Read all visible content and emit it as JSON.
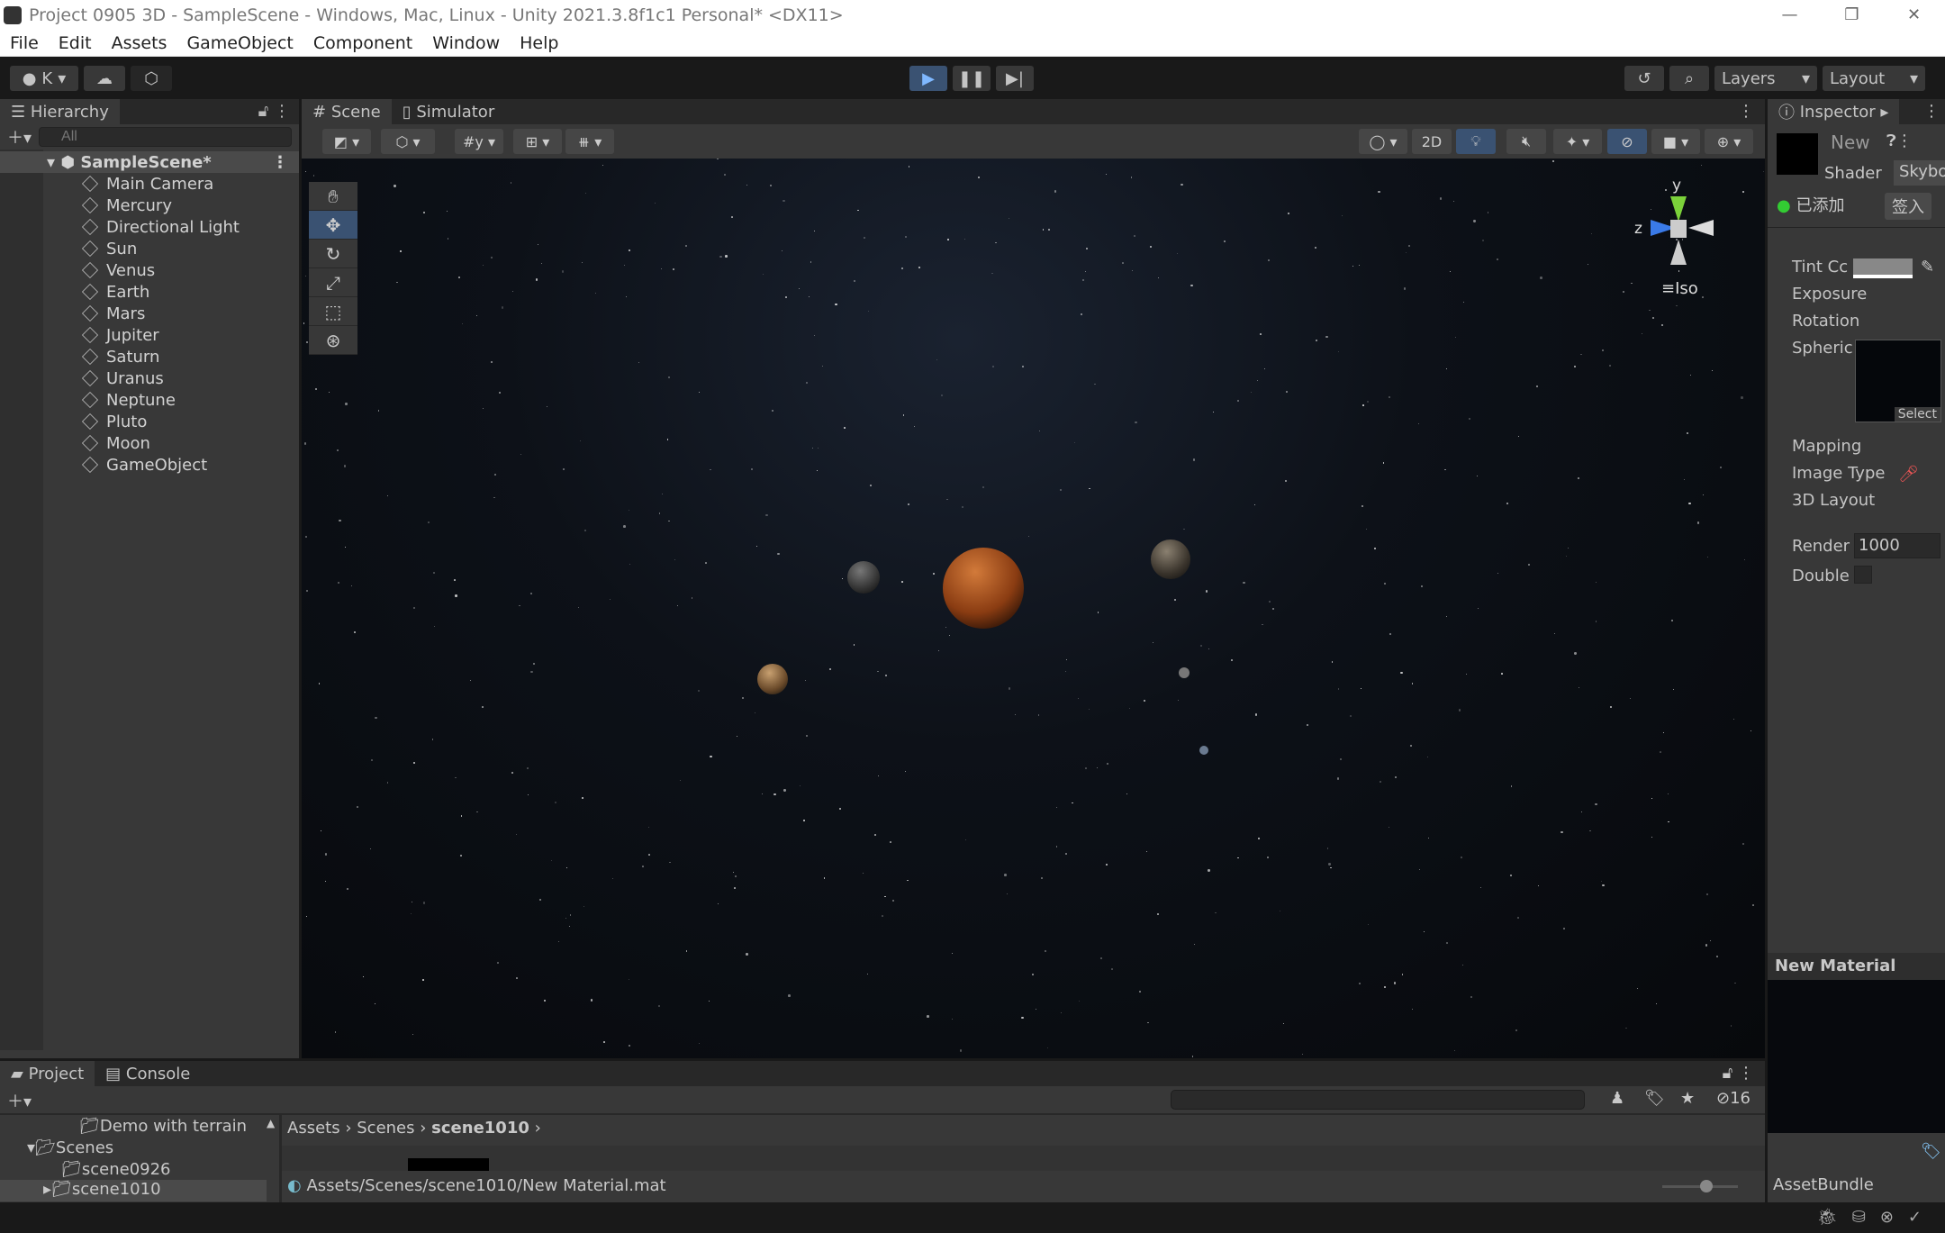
{
  "window": {
    "title": "Project 0905 3D - SampleScene - Windows, Mac, Linux - Unity 2021.3.8f1c1 Personal* <DX11>",
    "controls": [
      "—",
      "❐",
      "✕"
    ]
  },
  "menu": [
    "File",
    "Edit",
    "Assets",
    "GameObject",
    "Component",
    "Window",
    "Help"
  ],
  "toolbar": {
    "account": "K",
    "layers": "Layers",
    "layout": "Layout"
  },
  "hierarchy": {
    "tab": "Hierarchy",
    "search_placeholder": "All",
    "scene": "SampleScene*",
    "items": [
      "Main Camera",
      "Mercury",
      "Directional Light",
      "Sun",
      "Venus",
      "Earth",
      "Mars",
      "Jupiter",
      "Saturn",
      "Uranus",
      "Neptune",
      "Pluto",
      "Moon",
      "GameObject"
    ]
  },
  "scene": {
    "tabs": [
      "Scene",
      "Simulator"
    ],
    "btn_2d": "2D",
    "gizmo_y": "y",
    "gizmo_z": "z",
    "projection": "Iso"
  },
  "inspector": {
    "tab": "Inspector",
    "name": "New",
    "shader_label": "Shader",
    "shader_value": "Skybo",
    "added": "已添加",
    "checkin": "签入",
    "props": [
      "Tint Cc",
      "Exposure",
      "Rotation",
      "Spheric",
      "Mapping",
      "Image Type",
      "3D Layout"
    ],
    "render_label": "Render",
    "render_value": "1000",
    "double_label": "Double",
    "select": "Select",
    "preview_title": "New Material",
    "assetbundle": "AssetBundle"
  },
  "project": {
    "tabs": [
      "Project",
      "Console"
    ],
    "tree": [
      "Demo with terrain",
      "Scenes",
      "scene0926",
      "scene1010"
    ],
    "breadcrumb": [
      "Assets",
      "Scenes",
      "scene1010"
    ],
    "hidden_count": "16",
    "selected_path": "Assets/Scenes/scene1010/New Material.mat"
  },
  "colors": {
    "accent": "#3a5272",
    "panel": "#383838",
    "viewport": "#0b0d12"
  }
}
